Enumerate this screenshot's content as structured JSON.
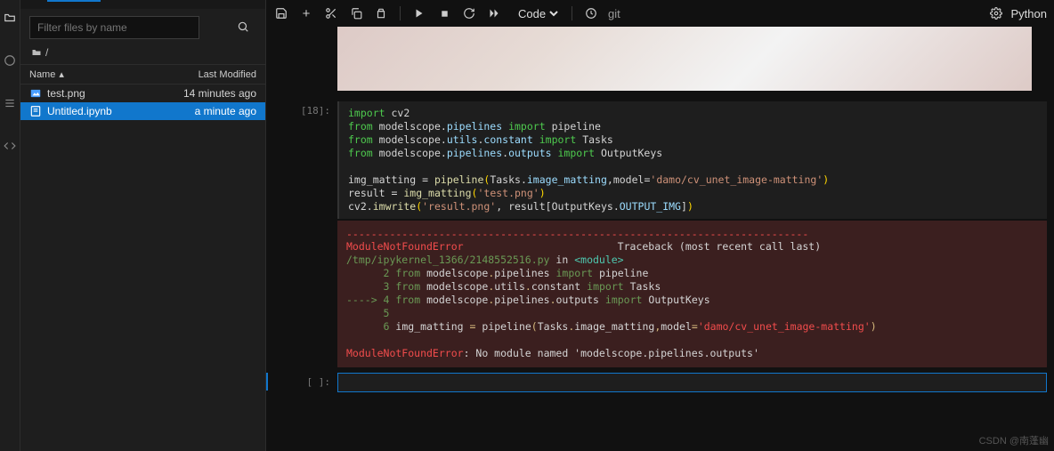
{
  "toolbar": {
    "kernel_type_label": "Code",
    "vcs_label": "git",
    "kernel_name": "Python"
  },
  "sidebar": {
    "filter_placeholder": "Filter files by name",
    "breadcrumb_icon": "folder-icon",
    "breadcrumb_path": "/",
    "columns": {
      "name": "Name",
      "modified": "Last Modified"
    },
    "files": [
      {
        "icon": "image-file-icon",
        "name": "test.png",
        "modified": "14 minutes ago",
        "selected": false
      },
      {
        "icon": "notebook-file-icon",
        "name": "Untitled.ipynb",
        "modified": "a minute ago",
        "selected": true
      }
    ]
  },
  "cells": {
    "c0": {
      "prompt": "[18]:",
      "code": {
        "l1a": "import",
        "l1b": "cv2",
        "l2a": "from",
        "l2b": "modelscope",
        "l2c": "pipelines",
        "l2d": "import",
        "l2e": "pipeline",
        "l3a": "from",
        "l3b": "modelscope",
        "l3c": "utils",
        "l3d": "constant",
        "l3e": "import",
        "l3f": "Tasks",
        "l4a": "from",
        "l4b": "modelscope",
        "l4c": "pipelines",
        "l4d": "outputs",
        "l4e": "import",
        "l4f": "OutputKeys",
        "l6a": "img_matting",
        "l6b": "=",
        "l6c": "pipeline",
        "l6d": "Tasks",
        "l6e": "image_matting",
        "l6f": "model",
        "l6g": "'damo/cv_unet_image-matting'",
        "l7a": "result",
        "l7b": "=",
        "l7c": "img_matting",
        "l7d": "'test.png'",
        "l8a": "cv2",
        "l8b": "imwrite",
        "l8c": "'result.png'",
        "l8d": "result",
        "l8e": "OutputKeys",
        "l8f": "OUTPUT_IMG"
      },
      "error": {
        "dash_line": "---------------------------------------------------------------------------",
        "err_name": "ModuleNotFoundError",
        "traceback_label": "Traceback (most recent call last)",
        "file_line": "/tmp/ipykernel_1366/2148552516.py",
        "in_label": "in",
        "module_label": "<module>",
        "ln2_num": "2",
        "ln2_from": "from",
        "ln2_mod": "modelscope",
        "ln2_p": "pipelines",
        "ln2_imp": "import",
        "ln2_tgt": "pipeline",
        "ln3_num": "3",
        "ln3_from": "from",
        "ln3_mod": "modelscope",
        "ln3_u": "utils",
        "ln3_c": "constant",
        "ln3_imp": "import",
        "ln3_tgt": "Tasks",
        "arrow": "----> ",
        "ln4_num": "4",
        "ln4_from": "from",
        "ln4_mod": "modelscope",
        "ln4_p": "pipelines",
        "ln4_o": "outputs",
        "ln4_imp": "import",
        "ln4_tgt": "OutputKeys",
        "ln5_num": "5",
        "ln6_num": "6",
        "ln6_a": "img_matting",
        "ln6_b": "=",
        "ln6_c": "pipeline",
        "ln6_d": "Tasks",
        "ln6_e": "image_matting",
        "ln6_f": "model",
        "ln6_g": "'damo/cv_unet_image-matting'",
        "final_err": "ModuleNotFoundError",
        "final_msg": ": No module named 'modelscope.pipelines.outputs'"
      }
    },
    "c1": {
      "prompt": "[ ]:"
    }
  },
  "watermark": "CSDN @南蓬幽"
}
